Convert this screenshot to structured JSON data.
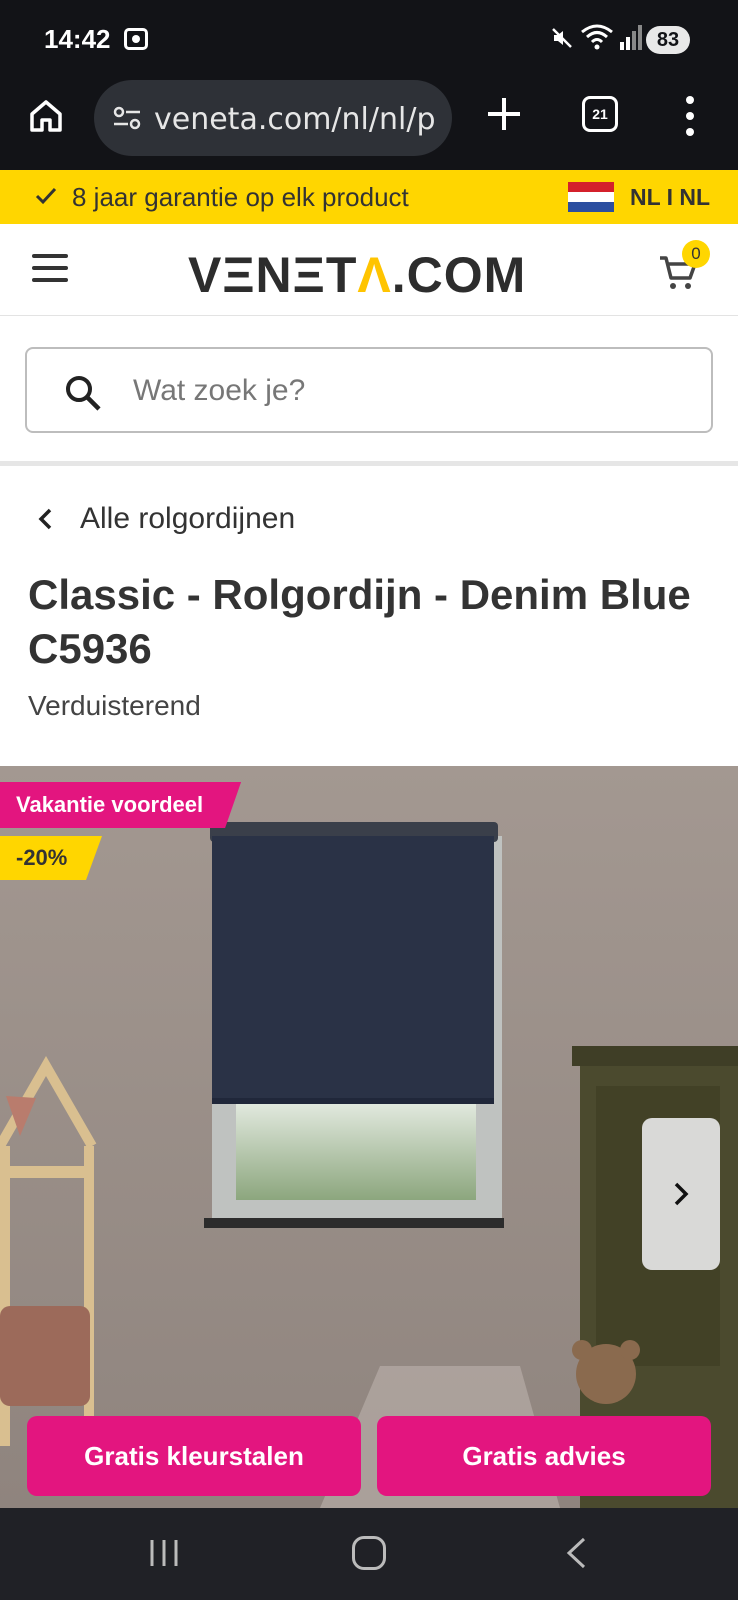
{
  "status_bar": {
    "time": "14:42",
    "battery": "83"
  },
  "browser": {
    "url": "veneta.com/nl/nl/p",
    "tab_count": "21"
  },
  "promo_bar": {
    "text": "8 jaar garantie op elk product",
    "language": "NL I NL"
  },
  "header": {
    "logo": "VΞNΞT",
    "logo_accent": "Λ",
    "logo_suffix": ".COM",
    "cart_count": "0"
  },
  "search": {
    "placeholder": "Wat zoek je?"
  },
  "product": {
    "back_label": "Alle rolgordijnen",
    "title": "Classic - Rolgordijn - Denim Blue C5936",
    "subtitle": "Verduisterend",
    "badge_promo": "Vakantie voordeel",
    "badge_discount": "-20%"
  },
  "actions": {
    "samples": "Gratis kleurstalen",
    "advice": "Gratis advies"
  },
  "colors": {
    "accent_pink": "#e3157f",
    "accent_yellow": "#ffd600",
    "blind_blue": "#2a3246"
  }
}
